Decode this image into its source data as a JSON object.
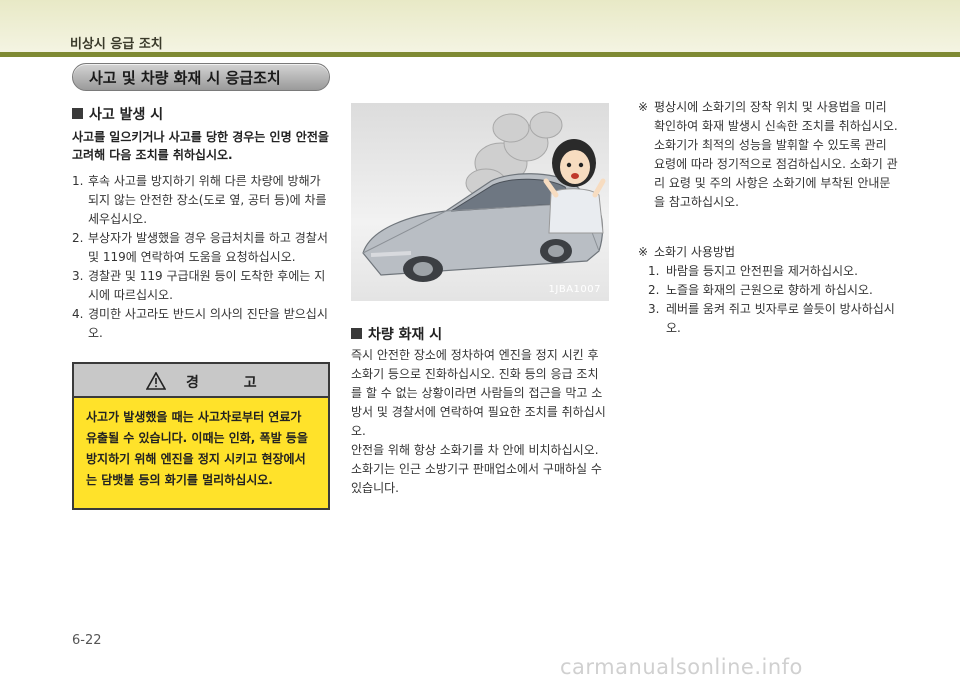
{
  "header": {
    "chapter_title": "비상시 응급 조치"
  },
  "section": {
    "title": "사고 및 차량 화재 시 응급조치"
  },
  "accident": {
    "heading": "사고 발생 시",
    "intro": "사고를 일으키거나 사고를 당한 경우는 인명 안전을 고려해 다음 조치를 취하십시오.",
    "items": [
      {
        "num": "1.",
        "text": "후속 사고를 방지하기 위해 다른 차량에 방해가 되지 않는 안전한 장소(도로 옆, 공터 등)에 차를 세우십시오."
      },
      {
        "num": "2.",
        "text": "부상자가 발생했을 경우 응급처치를 하고 경찰서 및 119에 연락하여 도움을 요청하십시오."
      },
      {
        "num": "3.",
        "text": "경찰관 및 119 구급대원 등이 도착한 후에는 지시에 따르십시오."
      },
      {
        "num": "4.",
        "text": "경미한 사고라도 반드시 의사의 진단을 받으십시오."
      }
    ]
  },
  "warning": {
    "label": "경 고",
    "icon": "warning-triangle-icon",
    "text": "사고가 발생했을 때는 사고차로부터 연료가 유출될 수 있습니다. 이때는 인화, 폭발 등을 방지하기 위해 엔진을 정지 시키고 현장에서는 담뱃불 등의 화기를 멀리하십시오."
  },
  "figure": {
    "code": "1JBA1007"
  },
  "fire": {
    "heading": "차량 화재 시",
    "paragraph1": "즉시 안전한 장소에 정차하여 엔진을 정지 시킨 후 소화기 등으로 진화하십시오. 진화 등의 응급 조치를 할 수 없는 상황이라면 사람들의 접근을 막고 소방서 및 경찰서에 연락하여 필요한 조치를 취하십시오.",
    "paragraph2": "안전을 위해 항상 소화기를 차 안에 비치하십시오.",
    "paragraph3": "소화기는 인근 소방기구 판매업소에서 구매하실 수 있습니다."
  },
  "notes": {
    "mark": "※",
    "note1": "평상시에 소화기의 장착 위치 및 사용법을 미리 확인하여 화재 발생시 신속한 조치를 취하십시오. 소화기가 최적의 성능을 발휘할 수 있도록 관리 요령에 따라 정기적으로 점검하십시오. 소화기 관리 요령 및 주의 사항은 소화기에 부착된 안내문을 참고하십시오.",
    "note2_title": "소화기 사용방법",
    "steps": [
      {
        "num": "1.",
        "text": "바람을 등지고 안전핀을 제거하십시오."
      },
      {
        "num": "2.",
        "text": "노즐을 화재의 근원으로 향하게 하십시오."
      },
      {
        "num": "3.",
        "text": "레버를 움켜 쥐고 빗자루로 쓸듯이 방사하십시오."
      }
    ]
  },
  "footer": {
    "page": "6-22",
    "watermark": "carmanualsonline.info"
  },
  "colors": {
    "accent_bar": "#7f8a33",
    "warning_bg": "#ffe22a",
    "header_band": "#e8e9c6"
  }
}
